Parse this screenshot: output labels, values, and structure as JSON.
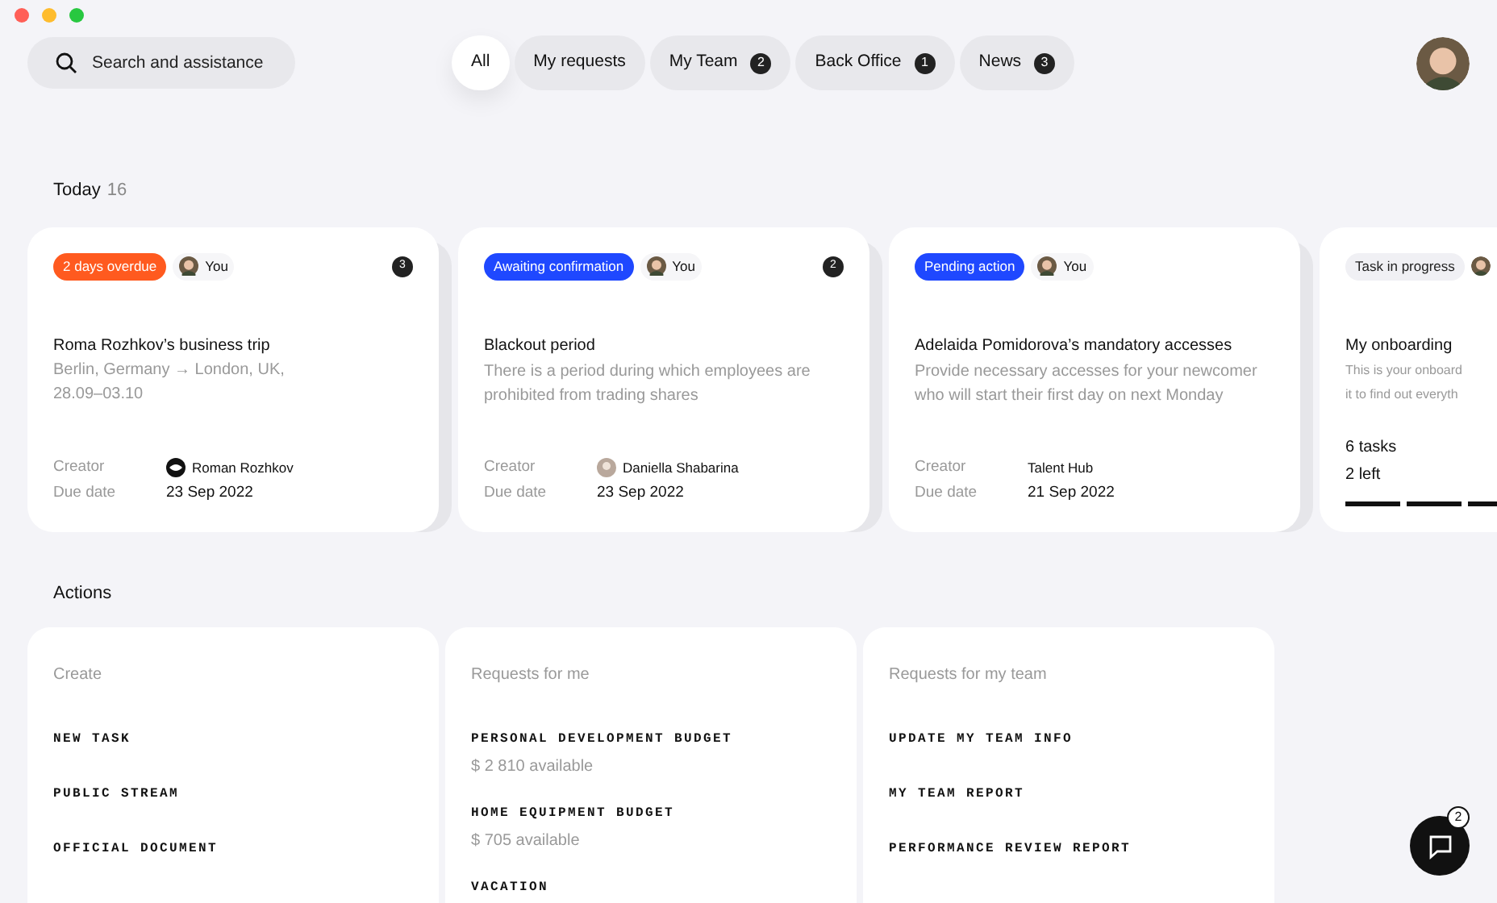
{
  "search": {
    "placeholder": "Search and assistance"
  },
  "tabs": [
    {
      "label": "All",
      "selected": true
    },
    {
      "label": "My requests",
      "selected": false
    },
    {
      "label": "My Team",
      "count": "2",
      "selected": false
    },
    {
      "label": "Back Office",
      "count": "1",
      "selected": false
    },
    {
      "label": "News",
      "count": "3",
      "selected": false
    }
  ],
  "today": {
    "title": "Today",
    "count": "16"
  },
  "cards": [
    {
      "status": {
        "label": "2 days overdue",
        "kind": "overdue"
      },
      "assignee": "You",
      "count": "3",
      "title": "Roma Rozhkov’s business trip",
      "description_lines": [
        "Berlin, Germany → London, UK,",
        "28.09–03.10"
      ],
      "creator_label": "Creator",
      "creator": {
        "name": "Roman Rozhkov",
        "kind": "logo"
      },
      "due_label": "Due date",
      "due": "23 Sep 2022"
    },
    {
      "status": {
        "label": "Awaiting confirmation",
        "kind": "waiting"
      },
      "assignee": "You",
      "count": "2",
      "title": "Blackout period",
      "description": "There is a period during which employees are prohibited from trading shares",
      "creator_label": "Creator",
      "creator": {
        "name": "Daniella Shabarina",
        "kind": "person"
      },
      "due_label": "Due date",
      "due": "23 Sep 2022"
    },
    {
      "status": {
        "label": "Pending action",
        "kind": "pending"
      },
      "assignee": "You",
      "title": "Adelaida Pomidorova’s mandatory accesses",
      "description": "Provide necessary accesses for your newcomer who will start their first day on next Monday",
      "creator_label": "Creator",
      "creator": {
        "name": "Talent Hub",
        "kind": "plain"
      },
      "due_label": "Due date",
      "due": "21 Sep 2022"
    },
    {
      "status": {
        "label": "Task in progress",
        "kind": "progress"
      },
      "title": "My onboarding",
      "description_lines": [
        "This is your onboard",
        "it to find out everyth"
      ],
      "tasks": "6 tasks",
      "left": "2 left"
    }
  ],
  "actions": {
    "title": "Actions",
    "groups": [
      {
        "title": "Create",
        "items": [
          {
            "label": "NEW TASK"
          },
          {
            "label": "PUBLIC STREAM"
          },
          {
            "label": "OFFICIAL DOCUMENT"
          }
        ]
      },
      {
        "title": "Requests for me",
        "items": [
          {
            "label": "PERSONAL DEVELOPMENT BUDGET",
            "note": "$ 2 810 available"
          },
          {
            "label": "HOME EQUIPMENT BUDGET",
            "note": "$ 705 available"
          },
          {
            "label": "VACATION"
          }
        ]
      },
      {
        "title": "Requests for my team",
        "items": [
          {
            "label": "UPDATE MY TEAM INFO"
          },
          {
            "label": "MY TEAM REPORT"
          },
          {
            "label": "PERFORMANCE REVIEW REPORT"
          }
        ]
      }
    ]
  },
  "chat": {
    "count": "2"
  }
}
